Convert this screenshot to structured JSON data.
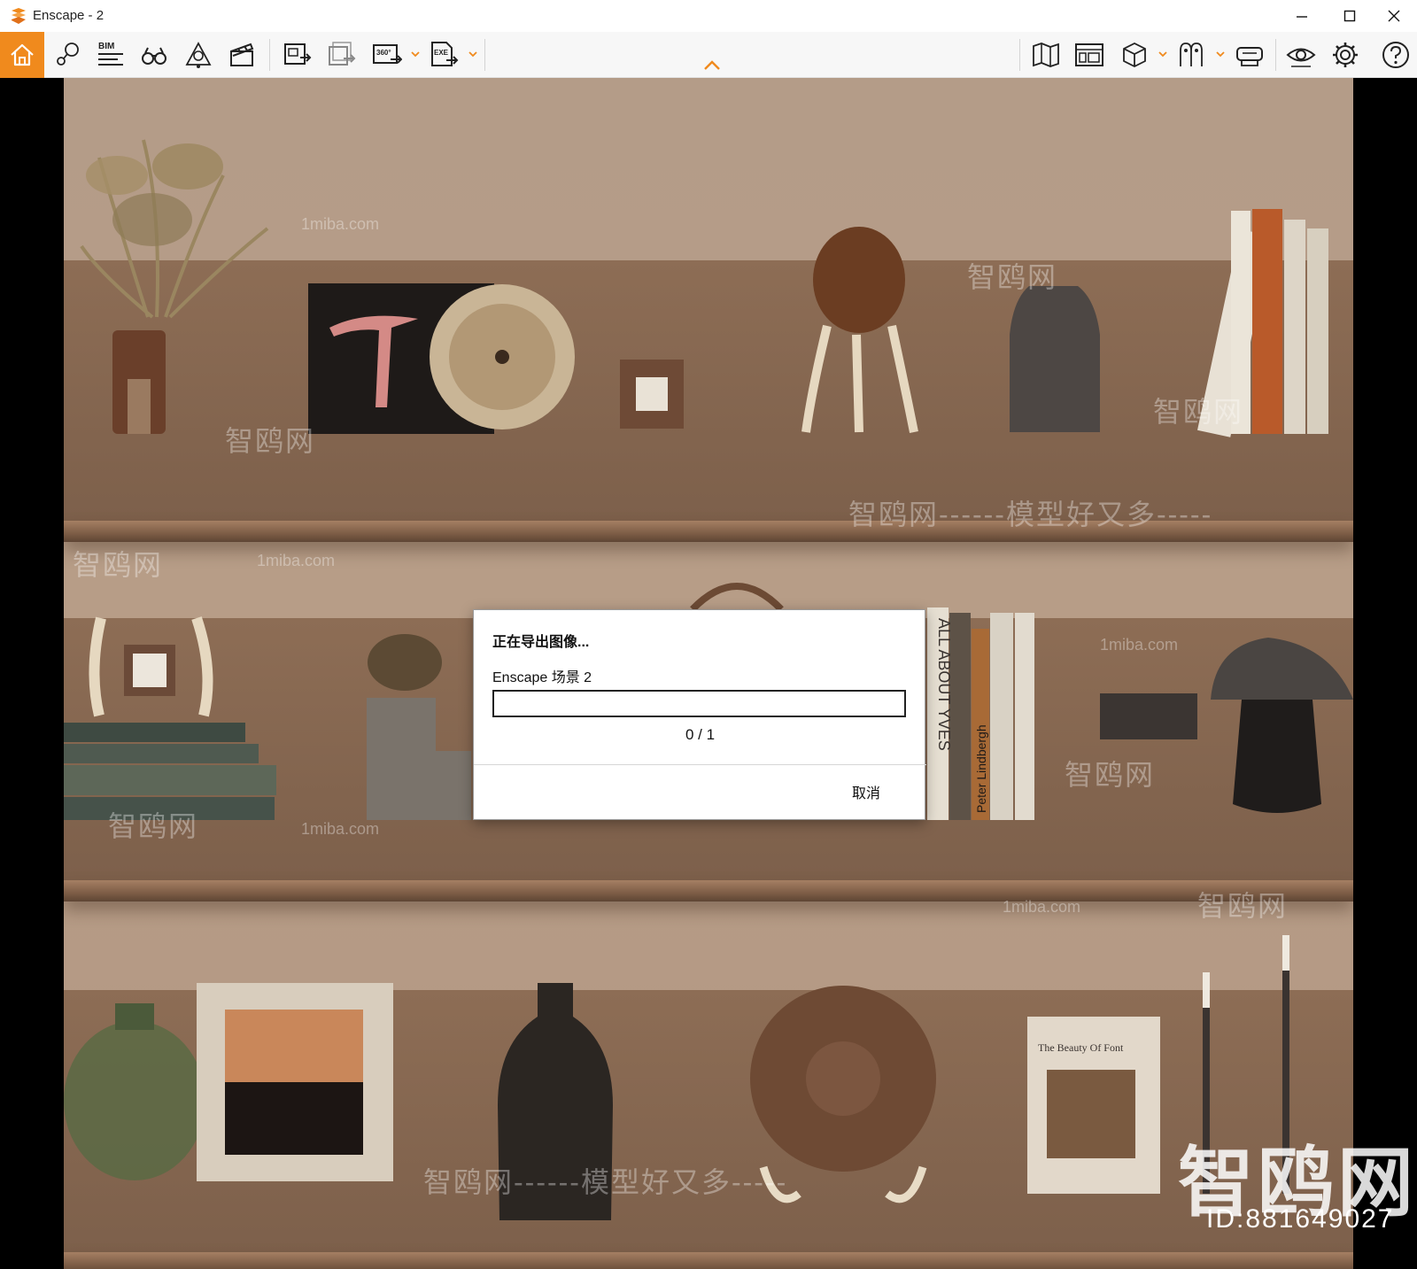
{
  "window": {
    "title": "Enscape - 2"
  },
  "toolbar": {
    "bim_label": "BIM",
    "panorama_label": "360°",
    "exe_label": "EXE"
  },
  "dialog": {
    "heading": "正在导出图像...",
    "scene_name": "Enscape 场景 2",
    "progress_fraction": 0,
    "progress_text": "0 / 1",
    "cancel_label": "取消"
  },
  "viewport": {
    "watermark_brand": "智鸥网",
    "watermark_slogan": "智鸥网------模型好又多-----",
    "watermark_domain": "1miba.com",
    "watermark_id": "ID:881649027",
    "book_titles": [
      "ALL ABOUT YVES",
      "Peter Lindbergh",
      "The Beauty Of Font"
    ]
  },
  "colors": {
    "accent": "#f08a1d",
    "wall": "#b49c88",
    "shelf": "#8d6d55"
  }
}
